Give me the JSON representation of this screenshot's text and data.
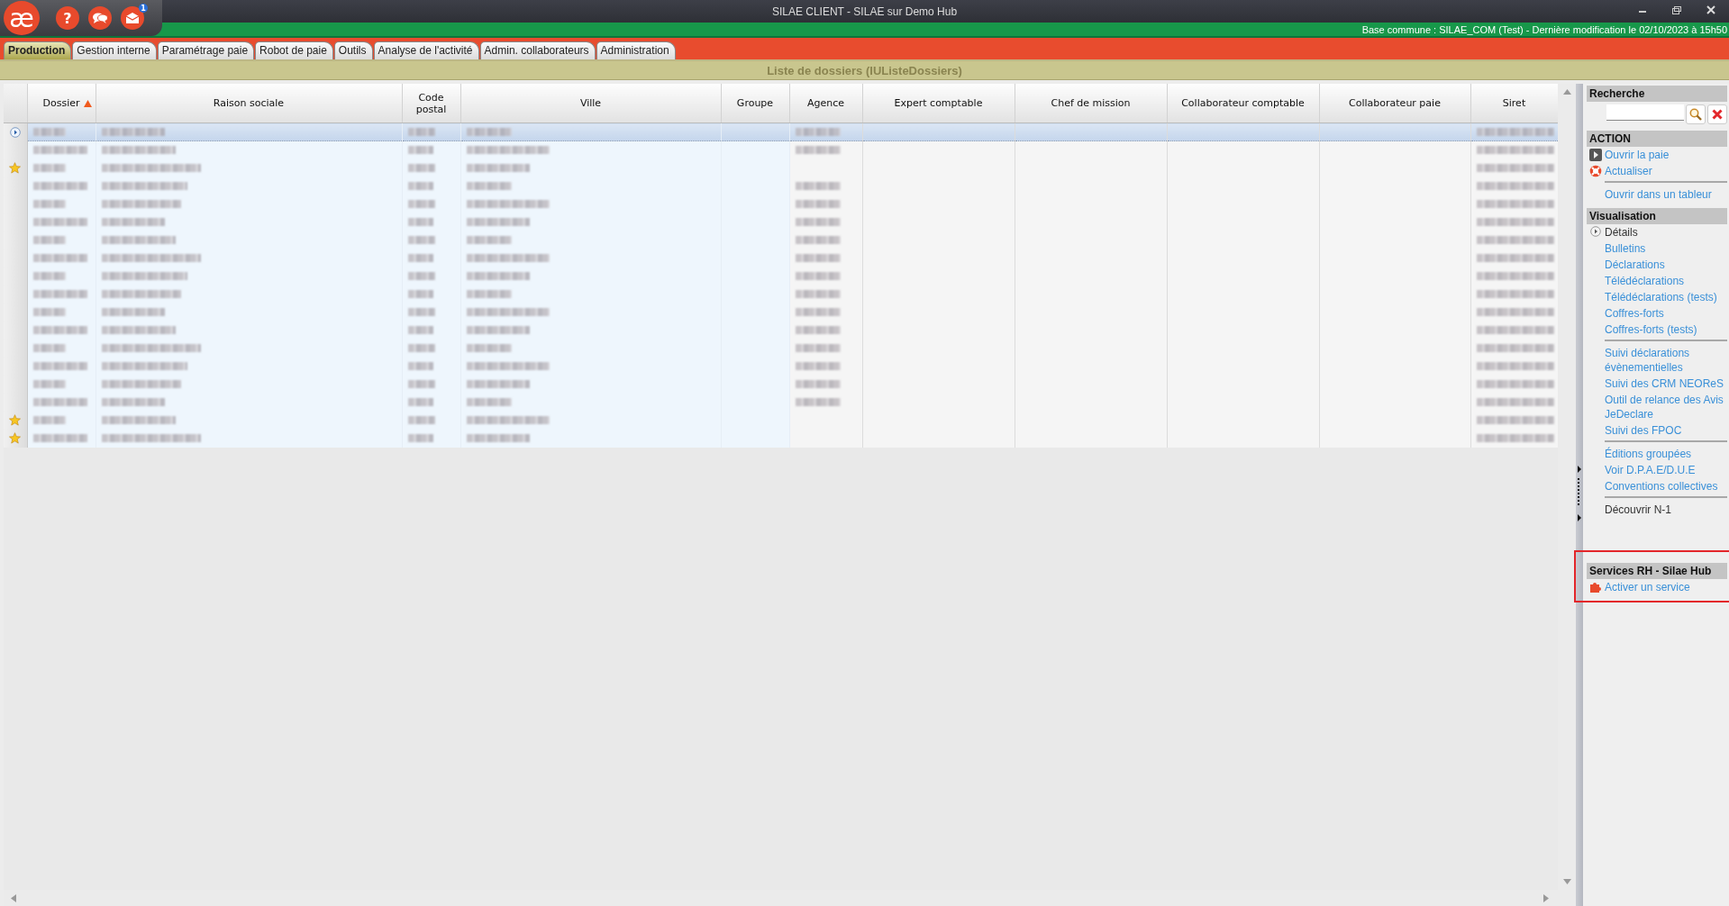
{
  "window": {
    "title": "SILAE CLIENT - SILAE sur Demo Hub"
  },
  "toolbar": {
    "logo": "æ",
    "help": "?",
    "notification_badge": "1"
  },
  "info_bar": {
    "text": "Base commune : SILAE_COM (Test) - Dernière modification le 02/10/2023 à 15h50"
  },
  "tabs": [
    {
      "label": "Production",
      "selected": true
    },
    {
      "label": "Gestion interne",
      "selected": false
    },
    {
      "label": "Paramétrage paie",
      "selected": false
    },
    {
      "label": "Robot de paie",
      "selected": false
    },
    {
      "label": "Outils",
      "selected": false
    },
    {
      "label": "Analyse de l'activité",
      "selected": false
    },
    {
      "label": "Admin. collaborateurs",
      "selected": false
    },
    {
      "label": "Administration",
      "selected": false
    }
  ],
  "list_title": "Liste de dossiers (IUListeDossiers)",
  "table": {
    "columns": [
      {
        "label": "Dossier",
        "sorted": true
      },
      {
        "label": "Raison sociale",
        "sorted": false
      },
      {
        "label": "Code postal",
        "sorted": false
      },
      {
        "label": "Ville",
        "sorted": false
      },
      {
        "label": "Groupe",
        "sorted": false
      },
      {
        "label": "Agence",
        "sorted": false
      },
      {
        "label": "Expert comptable",
        "sorted": false
      },
      {
        "label": "Chef de mission",
        "sorted": false
      },
      {
        "label": "Collaborateur comptable",
        "sorted": false
      },
      {
        "label": "Collaborateur paie",
        "sorted": false
      },
      {
        "label": "Siret",
        "sorted": false
      }
    ],
    "rows": [
      {
        "selected": true,
        "starred": false,
        "agency_redacted": true
      },
      {
        "selected": false,
        "starred": false,
        "agency_redacted": true
      },
      {
        "selected": false,
        "starred": true,
        "agency_redacted": false
      },
      {
        "selected": false,
        "starred": false,
        "agency_redacted": true
      },
      {
        "selected": false,
        "starred": false,
        "agency_redacted": true
      },
      {
        "selected": false,
        "starred": false,
        "agency_redacted": true
      },
      {
        "selected": false,
        "starred": false,
        "agency_redacted": true
      },
      {
        "selected": false,
        "starred": false,
        "agency_redacted": true
      },
      {
        "selected": false,
        "starred": false,
        "agency_redacted": true
      },
      {
        "selected": false,
        "starred": false,
        "agency_redacted": true
      },
      {
        "selected": false,
        "starred": false,
        "agency_redacted": true
      },
      {
        "selected": false,
        "starred": false,
        "agency_redacted": true
      },
      {
        "selected": false,
        "starred": false,
        "agency_redacted": true
      },
      {
        "selected": false,
        "starred": false,
        "agency_redacted": true
      },
      {
        "selected": false,
        "starred": false,
        "agency_redacted": true
      },
      {
        "selected": false,
        "starred": false,
        "agency_redacted": true
      },
      {
        "selected": false,
        "starred": true,
        "agency_redacted": false
      },
      {
        "selected": false,
        "starred": true,
        "agency_redacted": false
      }
    ]
  },
  "sidebar": {
    "sections": [
      {
        "title": "Recherche",
        "kind": "search",
        "highlighted": false
      },
      {
        "title": "ACTION",
        "kind": "list",
        "highlighted": false,
        "items": [
          {
            "kind": "play",
            "label": "Ouvrir la paie"
          },
          {
            "kind": "refresh",
            "label": "Actualiser"
          },
          {
            "kind": "separator"
          },
          {
            "kind": "link",
            "label": "Ouvrir dans un tableur"
          }
        ]
      },
      {
        "title": "Visualisation",
        "kind": "list",
        "highlighted": false,
        "items": [
          {
            "kind": "expander",
            "label": "Détails"
          },
          {
            "kind": "link",
            "label": "Bulletins"
          },
          {
            "kind": "link",
            "label": "Déclarations"
          },
          {
            "kind": "link",
            "label": "Télédéclarations"
          },
          {
            "kind": "link",
            "label": "Télédéclarations (tests)"
          },
          {
            "kind": "link",
            "label": "Coffres-forts"
          },
          {
            "kind": "link",
            "label": "Coffres-forts (tests)"
          },
          {
            "kind": "separator"
          },
          {
            "kind": "link",
            "label": "Suivi déclarations évènementielles"
          },
          {
            "kind": "link",
            "label": "Suivi des CRM NEOReS"
          },
          {
            "kind": "link",
            "label": "Outil de relance des Avis JeDeclare"
          },
          {
            "kind": "link",
            "label": "Suivi des FPOC"
          },
          {
            "kind": "separator"
          },
          {
            "kind": "link",
            "label": "Éditions groupées"
          },
          {
            "kind": "link",
            "label": "Voir D.P.A.E/D.U.E"
          },
          {
            "kind": "link",
            "label": "Conventions collectives"
          },
          {
            "kind": "separator"
          },
          {
            "kind": "text",
            "label": "Découvrir N-1"
          }
        ]
      },
      {
        "title": "Services RH - Silae Hub",
        "kind": "list",
        "highlighted": true,
        "items": [
          {
            "kind": "puzzle",
            "label": "Activer un service"
          }
        ]
      }
    ]
  }
}
